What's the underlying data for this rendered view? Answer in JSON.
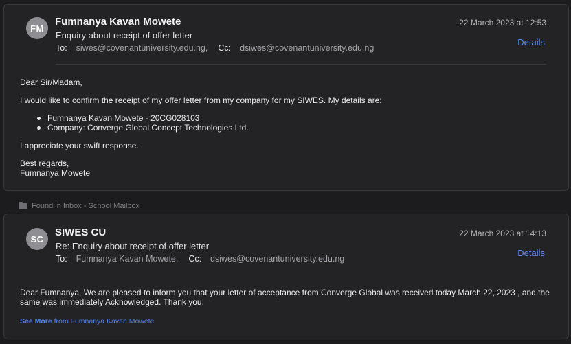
{
  "message1": {
    "avatar_initials": "FM",
    "sender": "Fumnanya Kavan Mowete",
    "subject": "Enquiry about receipt of offer letter",
    "to_label": "To:",
    "to_value": "siwes@covenantuniversity.edu.ng,",
    "cc_label": "Cc:",
    "cc_value": "dsiwes@covenantuniversity.edu.ng",
    "date": "22 March 2023 at 12:53",
    "details_label": "Details",
    "greeting": "Dear Sir/Madam,",
    "paragraph1": "I would like to confirm the receipt of my offer letter from my company for my SIWES. My details are:",
    "bullets": [
      "Fumnanya Kavan Mowete - 20CG028103",
      "Company: Converge Global Concept Technologies Ltd."
    ],
    "paragraph2": "I appreciate your swift response.",
    "signoff": "Best regards,",
    "signature": "Fumnanya Mowete"
  },
  "mailbox_label": "Found in Inbox - School Mailbox",
  "message2": {
    "avatar_initials": "SC",
    "sender": "SIWES CU",
    "subject": "Re: Enquiry about receipt of offer letter",
    "to_label": "To:",
    "to_value": "Fumnanya Kavan Mowete,",
    "cc_label": "Cc:",
    "cc_value": "dsiwes@covenantuniversity.edu.ng",
    "date": "22 March 2023 at 14:13",
    "details_label": "Details",
    "body": "Dear Fumnanya, We are pleased to inform you that your letter of acceptance from Converge Global was received today March 22, 2023 , and the same was immediately Acknowledged. Thank you.",
    "see_more_label": "See More",
    "see_more_from": "from Fumnanya Kavan Mowete"
  },
  "colors": {
    "accent": "#5a8dff",
    "background": "#1c1c1e",
    "card": "#232326",
    "avatar": "#8e8e93"
  },
  "icons": {
    "mailbox": "folder-icon"
  }
}
